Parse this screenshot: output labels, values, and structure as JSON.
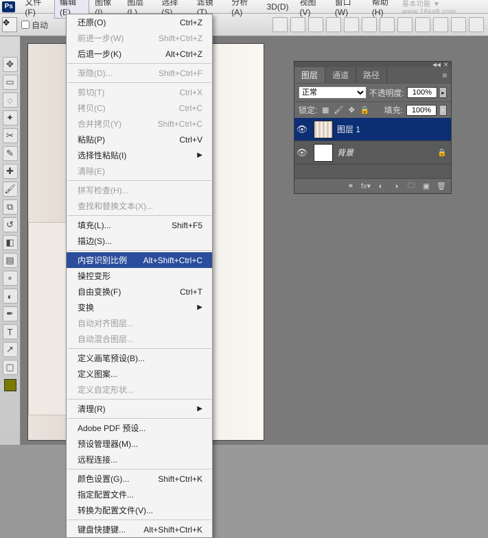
{
  "app_icon": "Ps",
  "menubar": {
    "items": [
      "文件(F)",
      "编辑(E)",
      "图像(I)",
      "图层(L)",
      "选择(S)",
      "滤镜(T)",
      "分析(A)",
      "3D(D)",
      "视图(V)",
      "窗口(W)",
      "帮助(H)"
    ],
    "tail": "基本功能 ▼  www.16xx8.com"
  },
  "options": {
    "auto_select": "自动"
  },
  "edit_menu": [
    {
      "label": "还原(O)",
      "shortcut": "Ctrl+Z",
      "disabled": false
    },
    {
      "label": "前进一步(W)",
      "shortcut": "Shift+Ctrl+Z",
      "disabled": true
    },
    {
      "label": "后退一步(K)",
      "shortcut": "Alt+Ctrl+Z",
      "disabled": false
    },
    {
      "sep": true
    },
    {
      "label": "渐隐(D)...",
      "shortcut": "Shift+Ctrl+F",
      "disabled": true
    },
    {
      "sep": true
    },
    {
      "label": "剪切(T)",
      "shortcut": "Ctrl+X",
      "disabled": true
    },
    {
      "label": "拷贝(C)",
      "shortcut": "Ctrl+C",
      "disabled": true
    },
    {
      "label": "合并拷贝(Y)",
      "shortcut": "Shift+Ctrl+C",
      "disabled": true
    },
    {
      "label": "粘贴(P)",
      "shortcut": "Ctrl+V",
      "disabled": false
    },
    {
      "label": "选择性粘贴(I)",
      "submenu": true,
      "disabled": false
    },
    {
      "label": "清除(E)",
      "disabled": true
    },
    {
      "sep": true
    },
    {
      "label": "拼写检查(H)...",
      "disabled": true
    },
    {
      "label": "查找和替换文本(X)...",
      "disabled": true
    },
    {
      "sep": true
    },
    {
      "label": "填充(L)...",
      "shortcut": "Shift+F5",
      "disabled": false
    },
    {
      "label": "描边(S)...",
      "disabled": false
    },
    {
      "sep": true
    },
    {
      "label": "内容识别比例",
      "shortcut": "Alt+Shift+Ctrl+C",
      "highlight": true
    },
    {
      "label": "操控变形",
      "disabled": false
    },
    {
      "label": "自由变换(F)",
      "shortcut": "Ctrl+T",
      "disabled": false
    },
    {
      "label": "变换",
      "submenu": true,
      "disabled": false
    },
    {
      "label": "自动对齐图层...",
      "disabled": true
    },
    {
      "label": "自动混合图层...",
      "disabled": true
    },
    {
      "sep": true
    },
    {
      "label": "定义画笔预设(B)...",
      "disabled": false
    },
    {
      "label": "定义图案...",
      "disabled": false
    },
    {
      "label": "定义自定形状...",
      "disabled": true
    },
    {
      "sep": true
    },
    {
      "label": "清理(R)",
      "submenu": true,
      "disabled": false
    },
    {
      "sep": true
    },
    {
      "label": "Adobe PDF 预设...",
      "disabled": false
    },
    {
      "label": "预设管理器(M)...",
      "disabled": false
    },
    {
      "label": "远程连接...",
      "disabled": false
    },
    {
      "sep": true
    },
    {
      "label": "颜色设置(G)...",
      "shortcut": "Shift+Ctrl+K",
      "disabled": false
    },
    {
      "label": "指定配置文件...",
      "disabled": false
    },
    {
      "label": "转换为配置文件(V)...",
      "disabled": false
    },
    {
      "sep": true
    },
    {
      "label": "键盘快捷键...",
      "shortcut": "Alt+Shift+Ctrl+K",
      "disabled": false
    }
  ],
  "layers_panel": {
    "tabs": [
      "图层",
      "通道",
      "路径"
    ],
    "blend_mode": "正常",
    "opacity_label": "不透明度:",
    "opacity_value": "100%",
    "lock_label": "锁定:",
    "fill_label": "填充:",
    "fill_value": "100%",
    "layers": [
      {
        "name": "图层 1",
        "selected": true,
        "thumb": "striped"
      },
      {
        "name": "背景",
        "selected": false,
        "locked": true,
        "thumb": "white"
      }
    ]
  }
}
